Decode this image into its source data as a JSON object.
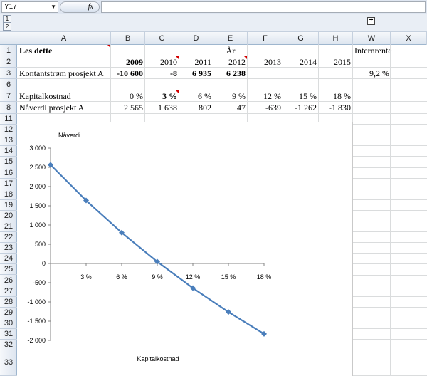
{
  "formula_bar": {
    "name_box": "Y17",
    "fx": "fx",
    "formula": ""
  },
  "outline": {
    "level1": "1",
    "level2": "2",
    "expand": "+"
  },
  "columns": [
    "A",
    "B",
    "C",
    "D",
    "E",
    "F",
    "G",
    "H",
    "W",
    "X"
  ],
  "rows": [
    "1",
    "2",
    "3",
    "6",
    "7",
    "8",
    "11",
    "12",
    "13",
    "14",
    "15",
    "16",
    "17",
    "18",
    "19",
    "20",
    "21",
    "22",
    "23",
    "24",
    "25",
    "26",
    "27",
    "28",
    "29",
    "30",
    "31",
    "32",
    "33"
  ],
  "sheet": {
    "a1": "Les dette",
    "e1": "År",
    "w1": "Internrente",
    "years": [
      "2009",
      "2010",
      "2011",
      "2012",
      "2013",
      "2014",
      "2015"
    ],
    "a3": "Kontantstrøm prosjekt A",
    "cashflows": [
      "-10 600",
      "-8",
      "6 935",
      "6 238"
    ],
    "w3": "9,2 %",
    "a7": "Kapitalkostnad",
    "rates": [
      "0 %",
      "3 %",
      "6 %",
      "9 %",
      "12 %",
      "15 %",
      "18 %"
    ],
    "a8": "Nåverdi prosjekt A",
    "npv": [
      "2 565",
      "1 638",
      "802",
      "47",
      "-639",
      "-1 262",
      "-1 830"
    ]
  },
  "chart_data": {
    "type": "line",
    "title": "",
    "ylabel": "Nåverdi",
    "xlabel": "Kapitalkostnad",
    "categories": [
      "0 %",
      "3 %",
      "6 %",
      "9 %",
      "12 %",
      "15 %",
      "18 %"
    ],
    "x": [
      0,
      3,
      6,
      9,
      12,
      15,
      18
    ],
    "series": [
      {
        "values": [
          2565,
          1638,
          802,
          47,
          -639,
          -1262,
          -1830
        ],
        "color": "#4a7ebb"
      }
    ],
    "ylim": [
      -2000,
      3000
    ],
    "yticks": [
      3000,
      2500,
      2000,
      1500,
      1000,
      500,
      0,
      -500,
      -1000,
      -1500,
      -2000
    ],
    "ytick_labels": [
      "3 000",
      "2 500",
      "2 000",
      "1 500",
      "1 000",
      "500",
      "0",
      "-500",
      "-1 000",
      "-1 500",
      "-2 000"
    ],
    "xtick_labels": [
      "3 %",
      "6 %",
      "9 %",
      "12 %",
      "15 %",
      "18 %"
    ],
    "grid": false,
    "legend": "none"
  }
}
